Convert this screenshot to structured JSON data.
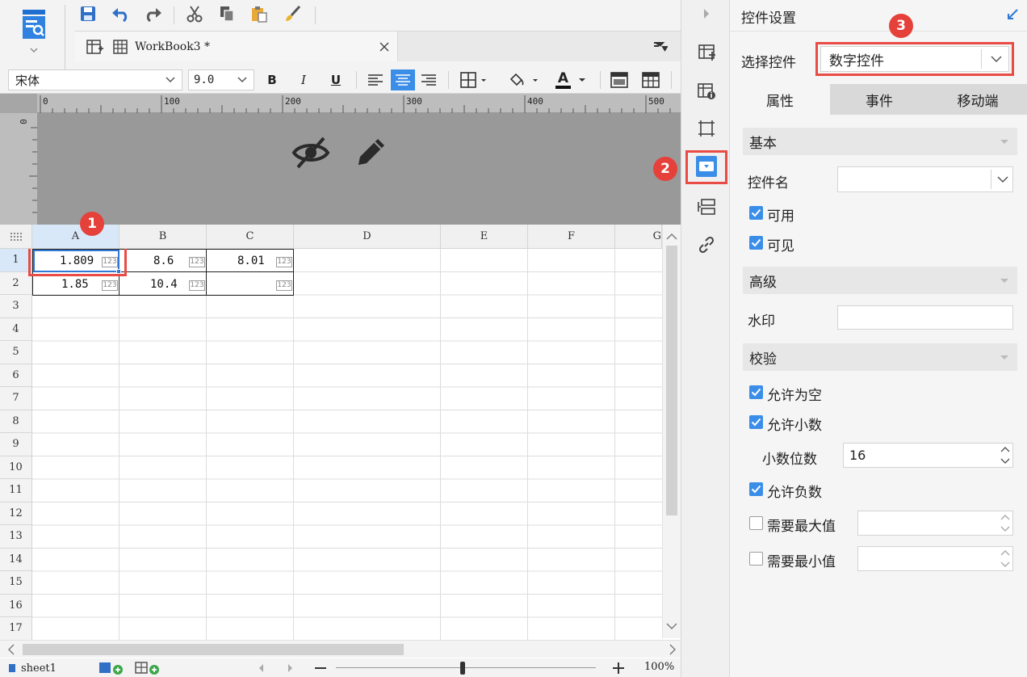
{
  "toolbar": {
    "tab_name": "WorkBook3 *",
    "font_name": "宋体",
    "font_size": "9.0",
    "bold": "B",
    "italic": "I",
    "underline": "U",
    "font_color_letter": "A"
  },
  "ruler": {
    "ticks": [
      "0",
      "100",
      "200",
      "300",
      "400",
      "500"
    ],
    "left_tick": "0"
  },
  "sheet": {
    "columns": [
      "A",
      "B",
      "C",
      "D",
      "E",
      "F",
      "G"
    ],
    "rows": [
      "1",
      "2",
      "3",
      "4",
      "5",
      "6",
      "7",
      "8",
      "9",
      "10",
      "11",
      "12",
      "13",
      "14",
      "15",
      "16",
      "17"
    ],
    "cells": {
      "A1": "1.809",
      "B1": "8.6",
      "C1": "8.01",
      "A2": "1.85",
      "B2": "10.4"
    },
    "widget_tag": "123",
    "sheet_tab": "sheet1",
    "zoom": "100%"
  },
  "panel": {
    "title": "控件设置",
    "select_label": "选择控件",
    "select_value": "数字控件",
    "tabs": [
      "属性",
      "事件",
      "移动端"
    ],
    "section_basic": "基本",
    "widget_name_label": "控件名",
    "widget_name_value": "",
    "enabled_label": "可用",
    "visible_label": "可见",
    "section_advanced": "高级",
    "watermark_label": "水印",
    "section_validation": "校验",
    "allow_empty_label": "允许为空",
    "allow_decimal_label": "允许小数",
    "decimal_places_label": "小数位数",
    "decimal_places_value": "16",
    "allow_negative_label": "允许负数",
    "need_max_label": "需要最大值",
    "need_min_label": "需要最小值"
  },
  "annotations": {
    "badge1": "1",
    "badge2": "2",
    "badge3": "3",
    "badge_color": "#e5413a"
  },
  "colors": {
    "accent": "#3b8ee8",
    "selection": "#2f78d6",
    "highlight_red": "#e94b45"
  }
}
